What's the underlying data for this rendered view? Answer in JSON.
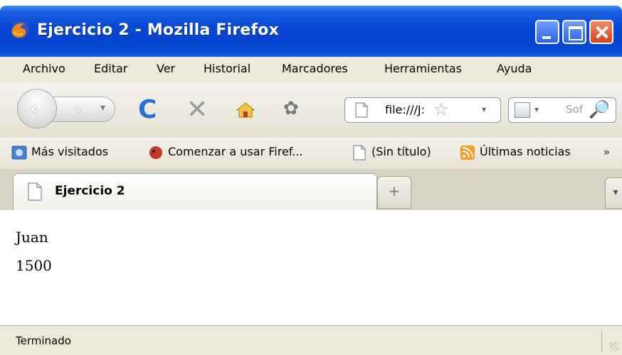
{
  "window": {
    "title": "Ejercicio 2 - Mozilla Firefox",
    "controls": {
      "minimize": "minimize",
      "maximize": "maximize",
      "close": "close"
    }
  },
  "menu": {
    "items": [
      {
        "label": "Archivo"
      },
      {
        "label": "Editar"
      },
      {
        "label": "Ver"
      },
      {
        "label": "Historial"
      },
      {
        "label": "Marcadores"
      },
      {
        "label": "Herramientas"
      },
      {
        "label": "Ayuda"
      }
    ]
  },
  "navigation": {
    "buttons": [
      "back-icon",
      "forward-icon",
      "reload-icon",
      "stop-icon",
      "home-icon",
      "addons-icon"
    ],
    "url": "file:///J:",
    "search": {
      "placeholder": "Sof"
    }
  },
  "bookmarks": {
    "items": [
      {
        "label": "Más visitados",
        "icon": "most-visited-icon"
      },
      {
        "label": "Comenzar a usar Firef...",
        "icon": "firefox-start-icon"
      },
      {
        "label": "(Sin título)",
        "icon": "page-icon"
      },
      {
        "label": "Últimas noticias",
        "icon": "rss-icon"
      }
    ],
    "more": "»"
  },
  "tabs": {
    "active": {
      "label": "Ejercicio 2"
    },
    "new_tab": "+",
    "scroll": "▾"
  },
  "content": {
    "lines": [
      "Juan",
      "1500"
    ]
  },
  "status": {
    "text": "Terminado"
  },
  "colors": {
    "titlebar": "#0a49d6",
    "chrome": "#ece9d8",
    "reload_accent": "#2a6fd6",
    "close_button": "#d5431c"
  }
}
